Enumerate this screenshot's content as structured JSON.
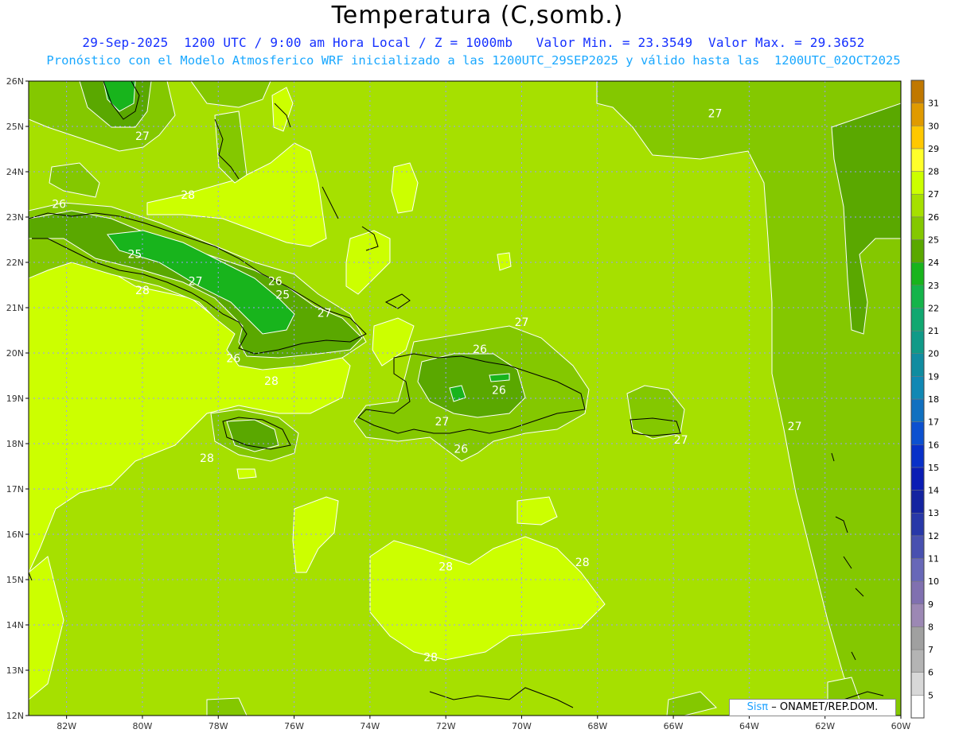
{
  "header": {
    "title": "Temperatura (C,somb.)",
    "line1": "29-Sep-2025  1200 UTC / 9:00 am Hora Local / Z = 1000mb   Valor Min. = 23.3549  Valor Max. = 29.3652",
    "line2": "Pronóstico con el Modelo Atmosferico WRF inicializado a las 1200UTC_29SEP2025 y válido hasta las  1200UTC_02OCT2025"
  },
  "map": {
    "lon_range": [
      -83,
      -60
    ],
    "lat_range": [
      12,
      26
    ],
    "lon_ticks": [
      "82W",
      "80W",
      "78W",
      "76W",
      "74W",
      "72W",
      "70W",
      "68W",
      "66W",
      "64W",
      "62W",
      "60W"
    ],
    "lat_ticks": [
      "12N",
      "13N",
      "14N",
      "15N",
      "16N",
      "17N",
      "18N",
      "19N",
      "20N",
      "21N",
      "22N",
      "23N",
      "24N",
      "25N",
      "26N"
    ],
    "contour_labels": [
      {
        "text": "27",
        "lon": -80.0,
        "lat": 24.7
      },
      {
        "text": "28",
        "lon": -78.8,
        "lat": 23.4
      },
      {
        "text": "26",
        "lon": -82.2,
        "lat": 23.2
      },
      {
        "text": "25",
        "lon": -80.2,
        "lat": 22.1
      },
      {
        "text": "27",
        "lon": -78.6,
        "lat": 21.5
      },
      {
        "text": "28",
        "lon": -80.0,
        "lat": 21.3
      },
      {
        "text": "26",
        "lon": -76.5,
        "lat": 21.5
      },
      {
        "text": "25",
        "lon": -76.3,
        "lat": 21.2
      },
      {
        "text": "27",
        "lon": -75.2,
        "lat": 20.8
      },
      {
        "text": "26",
        "lon": -77.6,
        "lat": 19.8
      },
      {
        "text": "28",
        "lon": -76.6,
        "lat": 19.3
      },
      {
        "text": "28",
        "lon": -78.3,
        "lat": 17.6
      },
      {
        "text": "27",
        "lon": -70.0,
        "lat": 20.6
      },
      {
        "text": "26",
        "lon": -71.1,
        "lat": 20.0
      },
      {
        "text": "26",
        "lon": -70.6,
        "lat": 19.1
      },
      {
        "text": "27",
        "lon": -72.1,
        "lat": 18.4
      },
      {
        "text": "26",
        "lon": -71.6,
        "lat": 17.8
      },
      {
        "text": "27",
        "lon": -65.8,
        "lat": 18.0
      },
      {
        "text": "27",
        "lon": -62.8,
        "lat": 18.3
      },
      {
        "text": "27",
        "lon": -64.9,
        "lat": 25.2
      },
      {
        "text": "28",
        "lon": -72.0,
        "lat": 15.2
      },
      {
        "text": "28",
        "lon": -68.4,
        "lat": 15.3
      },
      {
        "text": "28",
        "lon": -72.4,
        "lat": 13.2
      }
    ]
  },
  "colorbar": {
    "labels": [
      "5",
      "6",
      "7",
      "8",
      "9",
      "10",
      "11",
      "12",
      "13",
      "14",
      "15",
      "16",
      "17",
      "18",
      "19",
      "20",
      "21",
      "22",
      "23",
      "24",
      "25",
      "26",
      "27",
      "28",
      "29",
      "30",
      "31"
    ],
    "colors": [
      "#ffffff",
      "#d8d8d8",
      "#b4b4b4",
      "#a0a0a0",
      "#9c88b4",
      "#8070b0",
      "#6868b8",
      "#4850b0",
      "#2838a8",
      "#1424a0",
      "#0a1cb4",
      "#0830c8",
      "#0c50d0",
      "#1070c0",
      "#1088b4",
      "#108ca0",
      "#109a88",
      "#10a870",
      "#14b44a",
      "#18b41c",
      "#5aa800",
      "#84c800",
      "#a6e000",
      "#ccff00",
      "#ffff2a",
      "#ffc800",
      "#e09a00",
      "#c07800"
    ]
  },
  "credit": {
    "sis": "Sisπ",
    "org": "– ONAMET/REP.DOM."
  }
}
